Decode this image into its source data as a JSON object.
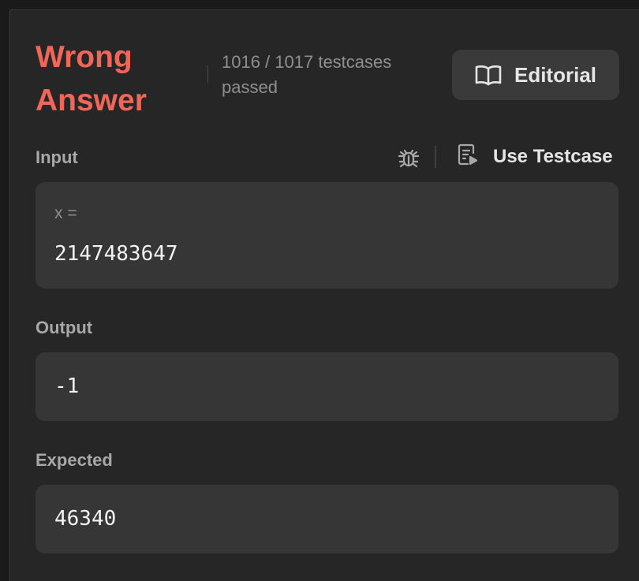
{
  "result": {
    "verdict": "Wrong Answer",
    "testcases_text": "1016 / 1017 testcases passed",
    "passed": 1016,
    "total": 1017,
    "verdict_color": "#f0675a"
  },
  "editorial": {
    "label": "Editorial",
    "icon": "book-open-icon"
  },
  "input": {
    "label": "Input",
    "debug_icon": "bug-icon",
    "use_testcase_icon": "document-play-icon",
    "use_testcase_label": "Use Testcase",
    "var_name": "x =",
    "value": "2147483647"
  },
  "output": {
    "label": "Output",
    "value": "-1"
  },
  "expected": {
    "label": "Expected",
    "value": "46340"
  }
}
